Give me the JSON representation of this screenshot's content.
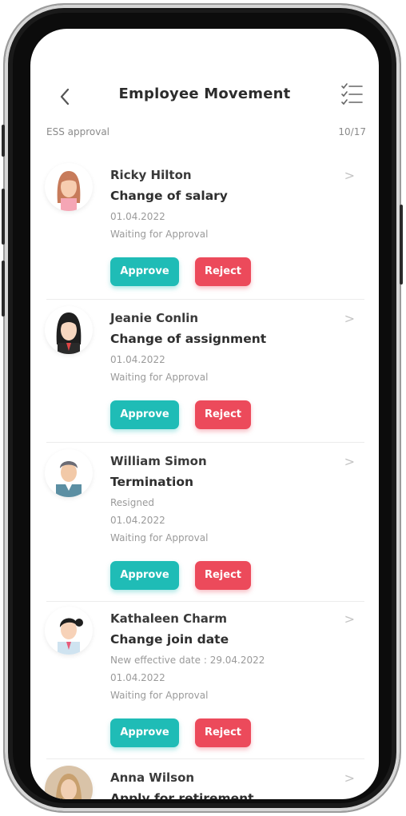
{
  "header": {
    "title": "Employee Movement"
  },
  "subheader": {
    "label": "ESS approval",
    "count": "10/17"
  },
  "colors": {
    "approve": "#1fbcb6",
    "reject": "#ec4a5b"
  },
  "icons": {
    "back": "chevron-left-icon",
    "list": "checklist-icon",
    "item": "chevron-right-icon"
  },
  "requests": [
    {
      "name": "Ricky Hilton",
      "type": "Change of salary",
      "details": [],
      "date": "01.04.2022",
      "status": "Waiting for Approval",
      "approve_label": "Approve",
      "reject_label": "Reject"
    },
    {
      "name": "Jeanie Conlin",
      "type": "Change of assignment",
      "details": [],
      "date": "01.04.2022",
      "status": "Waiting for Approval",
      "approve_label": "Approve",
      "reject_label": "Reject"
    },
    {
      "name": "William Simon",
      "type": "Termination",
      "details": [
        "Resigned"
      ],
      "date": "01.04.2022",
      "status": "Waiting for Approval",
      "approve_label": "Approve",
      "reject_label": "Reject"
    },
    {
      "name": "Kathaleen Charm",
      "type": "Change join date",
      "details": [
        "New effective date : 29.04.2022"
      ],
      "date": "01.04.2022",
      "status": "Waiting for Approval",
      "approve_label": "Approve",
      "reject_label": "Reject"
    },
    {
      "name": "Anna Wilson",
      "type": "Apply for retirement",
      "details": [],
      "date": "",
      "status": "",
      "approve_label": "",
      "reject_label": ""
    }
  ]
}
